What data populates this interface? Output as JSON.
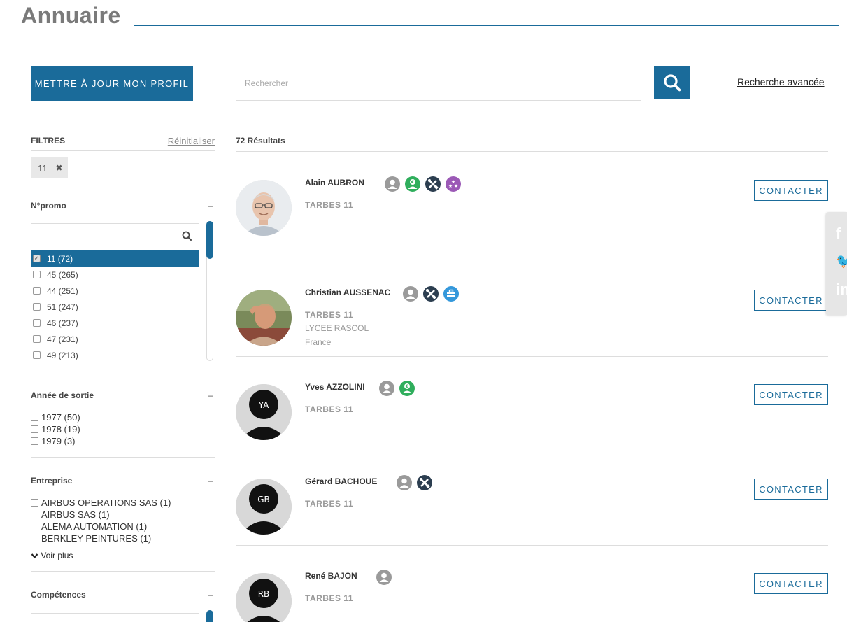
{
  "header": {
    "title": "Annuaire"
  },
  "toolbar": {
    "update_profile_label": "METTRE À JOUR MON PROFIL",
    "search_placeholder": "Rechercher",
    "advanced_search_label": "Recherche avancée"
  },
  "filters": {
    "title": "FILTRES",
    "reset_label": "Réinitialiser",
    "active_tags": [
      "11"
    ],
    "collapse_symbol": "–",
    "promo": {
      "title": "N°promo",
      "items": [
        {
          "label": "11 (72)",
          "checked": true
        },
        {
          "label": "45 (265)",
          "checked": false
        },
        {
          "label": "44 (251)",
          "checked": false
        },
        {
          "label": "51 (247)",
          "checked": false
        },
        {
          "label": "46 (237)",
          "checked": false
        },
        {
          "label": "47 (231)",
          "checked": false
        },
        {
          "label": "49 (213)",
          "checked": false
        }
      ]
    },
    "year": {
      "title": "Année de sortie",
      "items": [
        "1977 (50)",
        "1978 (19)",
        "1979 (3)"
      ]
    },
    "company": {
      "title": "Entreprise",
      "items": [
        "AIRBUS OPERATIONS SAS (1)",
        "AIRBUS SAS (1)",
        "ALEMA AUTOMATION (1)",
        "BERKLEY PEINTURES (1)"
      ],
      "see_more_label": "Voir plus"
    },
    "skills": {
      "title": "Compétences"
    }
  },
  "results": {
    "count_label": "72 Résultats",
    "contact_label": "CONTACTER",
    "people": [
      {
        "name": "Alain AUBRON",
        "line1": "TARBES 11",
        "line2": "",
        "line3": "",
        "initials": "",
        "photo": "photo-man-glasses",
        "badges": [
          "user-icon",
          "money-icon",
          "tools-icon",
          "stars-icon"
        ]
      },
      {
        "name": "Christian AUSSENAC",
        "line1": "TARBES 11",
        "line2": "LYCEE RASCOL",
        "line3": "France",
        "initials": "",
        "photo": "photo-man-outdoor",
        "badges": [
          "user-icon",
          "tools-icon",
          "briefcase-icon"
        ]
      },
      {
        "name": "Yves AZZOLINI",
        "line1": "TARBES 11",
        "line2": "",
        "line3": "",
        "initials": "YA",
        "photo": "",
        "badges": [
          "user-icon",
          "money-icon"
        ]
      },
      {
        "name": "Gérard BACHOUE",
        "line1": "TARBES 11",
        "line2": "",
        "line3": "",
        "initials": "GB",
        "photo": "",
        "badges": [
          "user-icon",
          "tools-icon"
        ]
      },
      {
        "name": "René BAJON",
        "line1": "TARBES 11",
        "line2": "",
        "line3": "",
        "initials": "RB",
        "photo": "",
        "badges": [
          "user-icon"
        ]
      }
    ]
  },
  "colors": {
    "primary": "#1a6b9a",
    "badge_user": "#9a9a9a",
    "badge_money": "#2fae5c",
    "badge_tools": "#2c3e50",
    "badge_stars": "#9b59b6",
    "badge_briefcase": "#3498db"
  },
  "social": [
    "facebook-icon",
    "twitter-icon",
    "linkedin-icon"
  ]
}
